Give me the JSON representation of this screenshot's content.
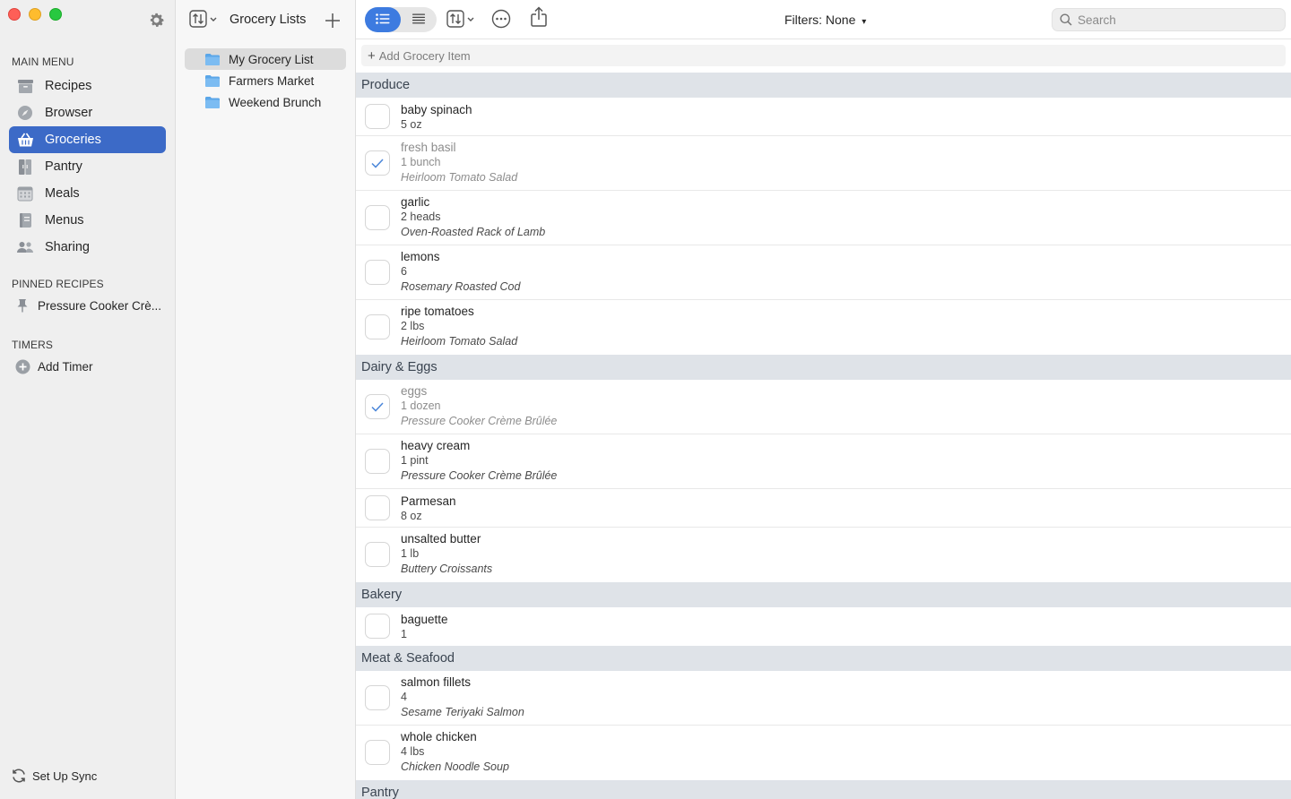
{
  "sidebar": {
    "main_menu_label": "MAIN MENU",
    "items": [
      {
        "label": "Recipes"
      },
      {
        "label": "Browser"
      },
      {
        "label": "Groceries"
      },
      {
        "label": "Pantry"
      },
      {
        "label": "Meals"
      },
      {
        "label": "Menus"
      },
      {
        "label": "Sharing"
      }
    ],
    "active_item": "Groceries",
    "pinned_label": "PINNED RECIPES",
    "pinned": [
      {
        "label": "Pressure Cooker Crè..."
      }
    ],
    "timers_label": "TIMERS",
    "add_timer_label": "Add Timer",
    "sync_label": "Set Up Sync"
  },
  "lists_panel": {
    "title": "Grocery Lists",
    "lists": [
      {
        "label": "My Grocery List"
      },
      {
        "label": "Farmers Market"
      },
      {
        "label": "Weekend Brunch"
      }
    ],
    "active_list": "My Grocery List"
  },
  "toolbar": {
    "filters_label": "Filters: None",
    "filters_caret": "▾",
    "search_placeholder": "Search"
  },
  "main": {
    "add_item_label": "Add Grocery Item",
    "categories": [
      {
        "name": "Produce",
        "items": [
          {
            "name": "baby spinach",
            "qty": "5 oz",
            "recipe": "",
            "checked": false
          },
          {
            "name": "fresh basil",
            "qty": "1 bunch",
            "recipe": "Heirloom Tomato Salad",
            "checked": true
          },
          {
            "name": "garlic",
            "qty": "2 heads",
            "recipe": "Oven-Roasted Rack of Lamb",
            "checked": false
          },
          {
            "name": "lemons",
            "qty": "6",
            "recipe": "Rosemary Roasted Cod",
            "checked": false
          },
          {
            "name": "ripe tomatoes",
            "qty": "2 lbs",
            "recipe": "Heirloom Tomato Salad",
            "checked": false
          }
        ]
      },
      {
        "name": "Dairy & Eggs",
        "items": [
          {
            "name": "eggs",
            "qty": "1 dozen",
            "recipe": "Pressure Cooker Crème Brûlée",
            "checked": true
          },
          {
            "name": "heavy cream",
            "qty": "1 pint",
            "recipe": "Pressure Cooker Crème Brûlée",
            "checked": false
          },
          {
            "name": "Parmesan",
            "qty": "8 oz",
            "recipe": "",
            "checked": false
          },
          {
            "name": "unsalted butter",
            "qty": "1 lb",
            "recipe": "Buttery Croissants",
            "checked": false
          }
        ]
      },
      {
        "name": "Bakery",
        "items": [
          {
            "name": "baguette",
            "qty": "1",
            "recipe": "",
            "checked": false
          }
        ]
      },
      {
        "name": "Meat & Seafood",
        "items": [
          {
            "name": "salmon fillets",
            "qty": "4",
            "recipe": "Sesame Teriyaki Salmon",
            "checked": false
          },
          {
            "name": "whole chicken",
            "qty": "4 lbs",
            "recipe": "Chicken Noodle Soup",
            "checked": false
          }
        ]
      },
      {
        "name": "Pantry",
        "items": []
      }
    ]
  },
  "colors": {
    "accent": "#3c6ac7",
    "toggle_accent": "#3d7be0",
    "category_band": "#dfe3e8",
    "check_mark": "#4a86d9"
  }
}
